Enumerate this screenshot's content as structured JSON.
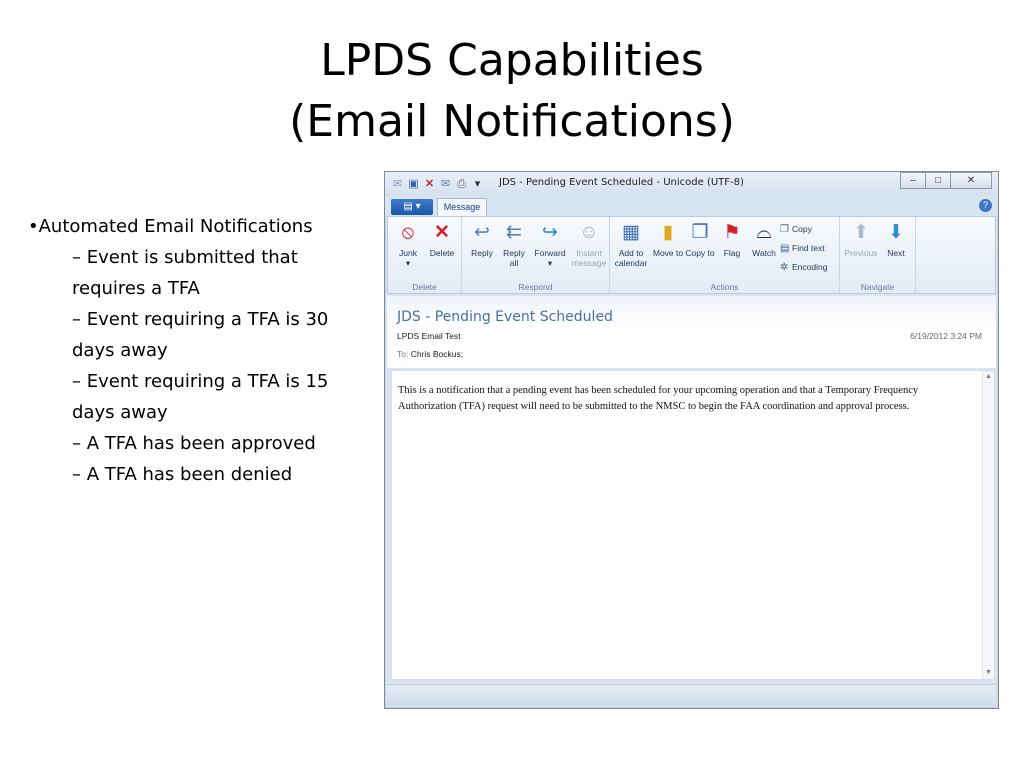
{
  "slide": {
    "title_line1": "LPDS Capabilities",
    "title_line2": "(Email Notifications)"
  },
  "bullets": {
    "main": "•Automated Email Notifications",
    "items": [
      "– Event is submitted that requires a TFA",
      "– Event requiring a TFA is 30 days away",
      "– Event requiring a TFA is 15 days away",
      "– A TFA has been approved",
      "– A TFA has been denied"
    ]
  },
  "window": {
    "title": "JDS - Pending Event Scheduled - Unicode (UTF-8)",
    "tab": "Message",
    "ribbon": {
      "delete_group": "Delete",
      "respond_group": "Respond",
      "actions_group": "Actions",
      "navigate_group": "Navigate",
      "junk": "Junk",
      "delete": "Delete",
      "reply": "Reply",
      "reply_all": "Reply all",
      "forward": "Forward",
      "instant_message": "Instant message",
      "add_to_calendar": "Add to calendar",
      "move_to": "Move to",
      "copy_to": "Copy to",
      "flag": "Flag",
      "watch": "Watch",
      "copy": "Copy",
      "find_text": "Find text",
      "encoding": "Encoding",
      "previous": "Previous",
      "next": "Next"
    },
    "message": {
      "subject": "JDS - Pending Event Scheduled",
      "sender": "LPDS Email Test",
      "date": "6/19/2012 3:24 PM",
      "to_label": "To:",
      "to": "Chris Bockus;",
      "body": "This is a notification that a pending event has been scheduled for your upcoming operation and that a Temporary Frequency Authorization (TFA) request will need to be submitted to the NMSC to begin the FAA coordination and approval process."
    }
  }
}
